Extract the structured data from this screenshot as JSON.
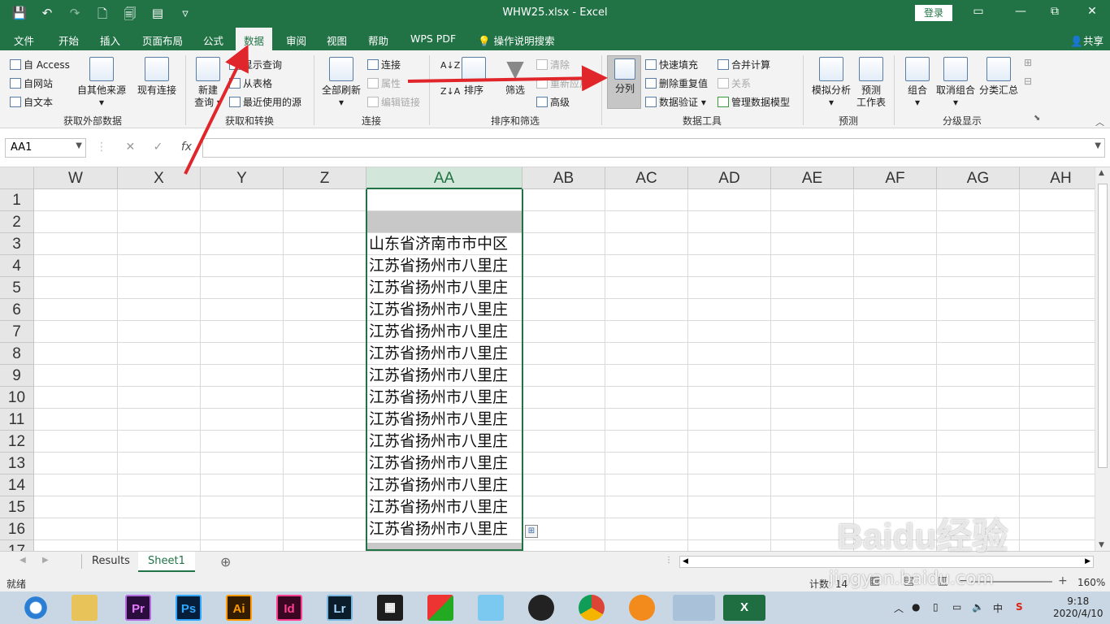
{
  "window": {
    "title": "WHW25.xlsx  -  Excel",
    "login_label": "登录",
    "min": "▭",
    "restore": "⧉",
    "close": "✕"
  },
  "qat": {
    "save": "💾",
    "undo": "↶",
    "redo": "↷",
    "new": "🗋",
    "preview": "🗐",
    "form": "▤",
    "more": "▿"
  },
  "ribbon_tabs": [
    "文件",
    "开始",
    "插入",
    "页面布局",
    "公式",
    "数据",
    "审阅",
    "视图",
    "帮助",
    "WPS PDF",
    "操作说明搜索"
  ],
  "ribbon_tab_active": "数据",
  "share_label": "共享",
  "groups": {
    "external": {
      "label": "获取外部数据",
      "access": "自 Access",
      "web": "自网站",
      "text": "自文本",
      "other": "自其他来源",
      "existing": "现有连接"
    },
    "transform": {
      "label": "获取和转换",
      "new_query": "新建",
      "new_query2": "查询",
      "show_query": "显示查询",
      "from_table": "从表格",
      "recent": "最近使用的源"
    },
    "connections": {
      "label": "连接",
      "refresh": "全部刷新",
      "connections": "连接",
      "properties": "属性",
      "edit_links": "编辑链接"
    },
    "sort_filter": {
      "label": "排序和筛选",
      "sort": "排序",
      "filter": "筛选",
      "clear": "清除",
      "reapply": "重新应用",
      "advanced": "高级"
    },
    "data_tools": {
      "label": "数据工具",
      "split": "分列",
      "flash_fill": "快速填充",
      "remove_dup": "删除重复值",
      "validation": "数据验证",
      "consolidate": "合并计算",
      "relations": "关系",
      "model": "管理数据模型"
    },
    "forecast": {
      "label": "预测",
      "whatif": "模拟分析",
      "sheet": "预测",
      "sheet2": "工作表"
    },
    "outline": {
      "label": "分级显示",
      "group": "组合",
      "ungroup": "取消组合",
      "subtotal": "分类汇总"
    }
  },
  "formula_bar": {
    "name_box": "AA1",
    "cancel": "✕",
    "enter": "✓",
    "fx": "fx",
    "value": ""
  },
  "columns": [
    "W",
    "X",
    "Y",
    "Z",
    "AA",
    "AB",
    "AC",
    "AD",
    "AE",
    "AF",
    "AG",
    "AH"
  ],
  "rows": [
    "1",
    "2",
    "3",
    "4",
    "5",
    "6",
    "7",
    "8",
    "9",
    "10",
    "11",
    "12",
    "13",
    "14",
    "15",
    "16",
    "17"
  ],
  "selected_column": "AA",
  "cells_aa": [
    "",
    "",
    "山东省济南市市中区",
    "江苏省扬州市八里庄",
    "江苏省扬州市八里庄",
    "江苏省扬州市八里庄",
    "江苏省扬州市八里庄",
    "江苏省扬州市八里庄",
    "江苏省扬州市八里庄",
    "江苏省扬州市八里庄",
    "江苏省扬州市八里庄",
    "江苏省扬州市八里庄",
    "江苏省扬州市八里庄",
    "江苏省扬州市八里庄",
    "江苏省扬州市八里庄",
    "江苏省扬州市八里庄",
    ""
  ],
  "sheets": [
    "Results",
    "Sheet1"
  ],
  "active_sheet": "Sheet1",
  "add_sheet": "⊕",
  "status": {
    "ready": "就绪",
    "count": "计数: 14",
    "zoom": "160%",
    "plus": "+"
  },
  "taskbar": {
    "apps": [
      "Pr",
      "Ps",
      "Ai",
      "Id",
      "Lr"
    ],
    "time": "9:18",
    "date": "2020/4/10",
    "ime": "中"
  },
  "watermark": {
    "brand": "Baidu经验",
    "url": "jingyan.baidu.com"
  },
  "colors": {
    "excel_green": "#217346",
    "arrow_red": "#e0262b"
  }
}
